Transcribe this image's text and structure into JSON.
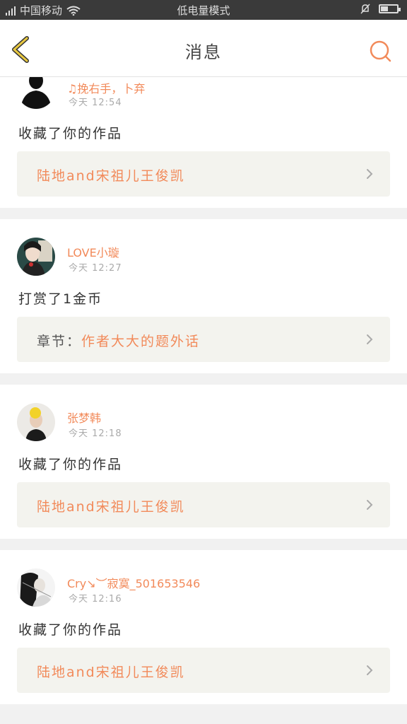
{
  "status_bar": {
    "carrier": "中国移动",
    "mode_text": "低电量模式"
  },
  "header": {
    "title": "消息"
  },
  "messages": [
    {
      "user": "♫挽右手，卜弃",
      "time": "今天 12:54",
      "action": "收藏了你的作品",
      "link_prefix": "",
      "link_text": "陆地and宋祖儿王俊凯"
    },
    {
      "user": "LOVE小璇",
      "time": "今天 12:27",
      "action": "打赏了1金币",
      "link_prefix": "章节：",
      "link_text": "作者大大的题外话"
    },
    {
      "user": "张梦韩",
      "time": "今天 12:18",
      "action": "收藏了你的作品",
      "link_prefix": "",
      "link_text": "陆地and宋祖儿王俊凯"
    },
    {
      "user": "Cry↘︶寂寞_501653546",
      "time": "今天 12:16",
      "action": "收藏了你的作品",
      "link_prefix": "",
      "link_text": "陆地and宋祖儿王俊凯"
    }
  ],
  "colors": {
    "accent": "#f28a5a",
    "back_arrow": "#e8c840",
    "card_link_bg": "#f3f3ee"
  },
  "icons": {
    "back": "back-arrow-icon",
    "search": "search-icon",
    "chevron": "chevron-right-icon"
  }
}
